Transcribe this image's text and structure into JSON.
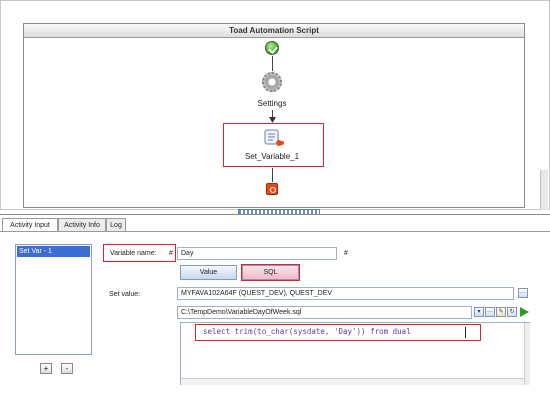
{
  "workflow": {
    "title": "Toad Automation Script",
    "nodes": {
      "start": {
        "icon": "start-check-icon"
      },
      "settings": {
        "label": "Settings",
        "icon": "gear-icon"
      },
      "set_variable": {
        "label": "Set_Variable_1",
        "icon": "script-scroll-icon"
      },
      "end": {
        "icon": "stop-icon"
      }
    }
  },
  "tabs": [
    {
      "label": "Activity Input"
    },
    {
      "label": "Activity Info"
    },
    {
      "label": "Log"
    }
  ],
  "activity_list": {
    "items": [
      "Set Var - 1"
    ],
    "add_label": "+",
    "remove_label": "-"
  },
  "form": {
    "variable_name_label": "Variable name:",
    "hash_left": "#",
    "variable_name_value": "Day",
    "hash_right": "#",
    "value_toggle": "Value",
    "sql_toggle": "SQL",
    "set_value_label": "Set value:",
    "connection_value": "MYFAVA102A64F (QUEST_DEV), QUEST_DEV",
    "file_path_value": "C:\\TempDemo\\VariableDayOfWeek.sql",
    "sql_text": "select trim(to_char(sysdate, 'Day')) from dual"
  },
  "colors": {
    "highlight": "#e0202a",
    "selection": "#3b6ed0",
    "sql_keyword": "#4a3fb0"
  }
}
